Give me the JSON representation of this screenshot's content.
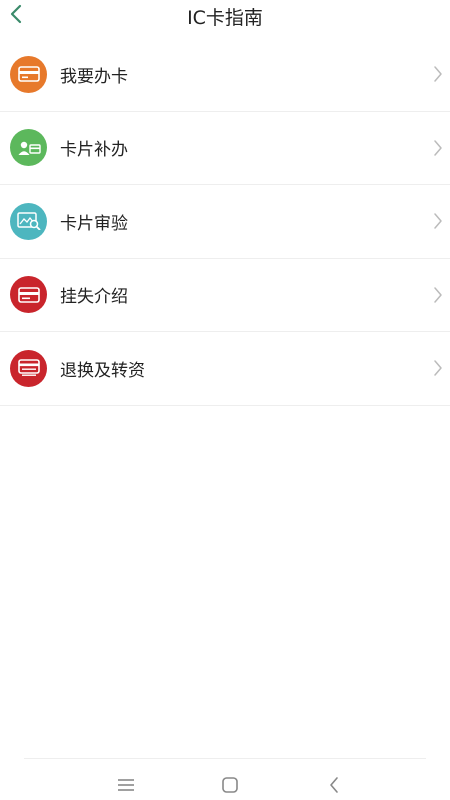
{
  "header": {
    "title": "IC卡指南",
    "back_icon": "chevron-left-icon",
    "accent": "#3a8a6a"
  },
  "menu": [
    {
      "label": "我要办卡",
      "icon": "card-icon",
      "color": "#e7792b"
    },
    {
      "label": "卡片补办",
      "icon": "user-card-icon",
      "color": "#5cb85c"
    },
    {
      "label": "卡片审验",
      "icon": "card-inspect-icon",
      "color": "#4db6bf"
    },
    {
      "label": "挂失介绍",
      "icon": "card-icon",
      "color": "#c9252c"
    },
    {
      "label": "退换及转资",
      "icon": "card-transfer-icon",
      "color": "#c9252c"
    }
  ],
  "navbar": {
    "items": [
      "menu-icon",
      "home-square-icon",
      "back-triangle-icon"
    ]
  }
}
